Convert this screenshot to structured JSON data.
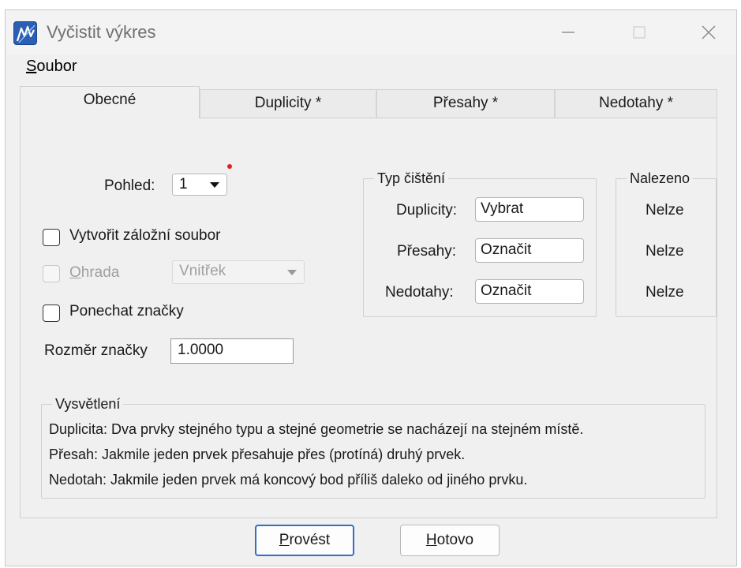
{
  "window": {
    "title": "Vyčistit výkres",
    "icon": "microstation-app-icon",
    "controls": [
      "minimize-icon",
      "maximize-icon",
      "close-icon"
    ]
  },
  "menu": {
    "items": [
      {
        "accel": "S",
        "rest": "oubor"
      }
    ]
  },
  "tabs": [
    {
      "label": "Obecné",
      "active": true
    },
    {
      "label": "Duplicity *",
      "active": false
    },
    {
      "label": "Přesahy *",
      "active": false
    },
    {
      "label": "Nedotahy *",
      "active": false
    }
  ],
  "general": {
    "view_label": "Pohled:",
    "view_value": "1",
    "backup_label": "Vytvořit záložní soubor",
    "fence_accel": "O",
    "fence_rest": "hrada",
    "fence_mode_value": "Vnitřek",
    "keep_marks_label": "Ponechat značky",
    "mark_size_label": "Rozměr značky",
    "mark_size_value": "1.0000"
  },
  "cleanup_type": {
    "legend": "Typ čištění",
    "rows": [
      {
        "label": "Duplicity:",
        "value": "Vybrat"
      },
      {
        "label": "Přesahy:",
        "value": "Označit"
      },
      {
        "label": "Nedotahy:",
        "value": "Označit"
      }
    ]
  },
  "found": {
    "legend": "Nalezeno",
    "values": [
      "Nelze",
      "Nelze",
      "Nelze"
    ]
  },
  "explanation": {
    "legend": "Vysvětlení",
    "lines": [
      "Duplicita: Dva prvky stejného typu a stejné geometrie se nacházejí na stejném místě.",
      "Přesah: Jakmile jeden prvek přesahuje přes (protíná) druhý prvek.",
      "Nedotah: Jakmile jeden prvek má koncový bod příliš daleko od jiného prvku."
    ]
  },
  "buttons": {
    "run_accel": "P",
    "run_rest": "rovést",
    "done_accel": "H",
    "done_rest": "otovo"
  },
  "colors": {
    "default_button_border": "#2f6fc4",
    "red_indicator": "#e02020",
    "app_icon_bg": "#2b5fb3"
  }
}
